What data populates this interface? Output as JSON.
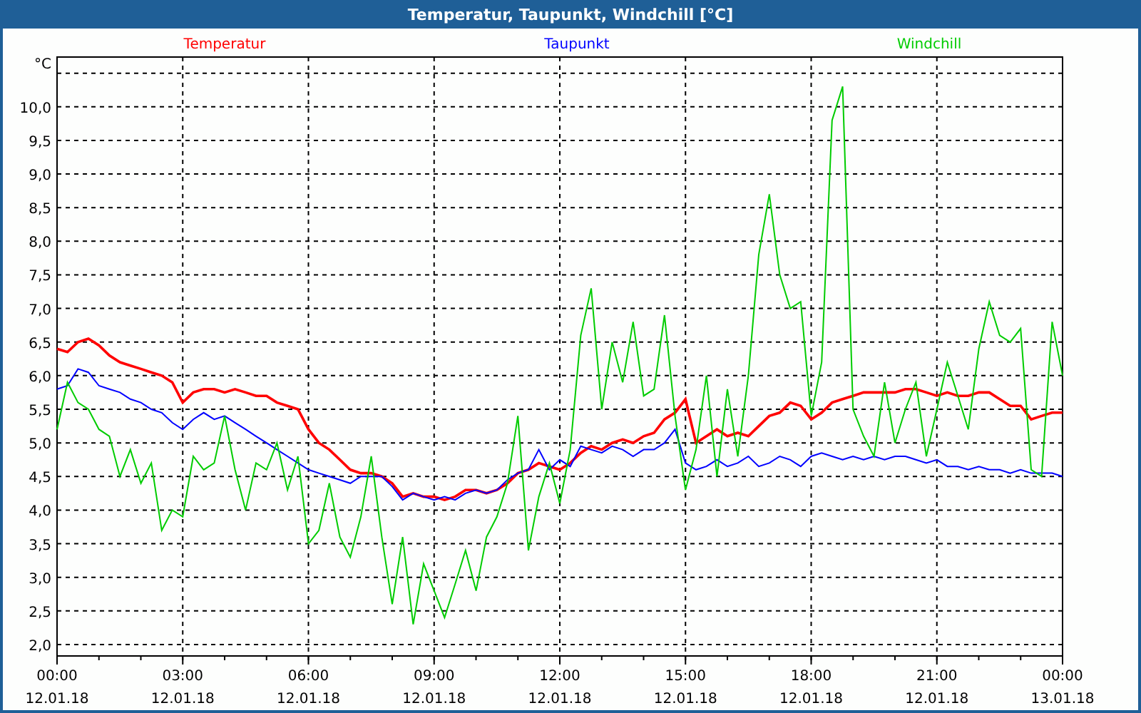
{
  "window": {
    "title": "Temperatur, Taupunkt, Windchill [°C]"
  },
  "chart": {
    "chart_data": {
      "type": "line",
      "ylabel": "°C",
      "categories": [
        "00:00\n12.01.18",
        null,
        null,
        null,
        null,
        null,
        null,
        null,
        null,
        null,
        null,
        null,
        "03:00\n12.01.18",
        null,
        null,
        null,
        null,
        null,
        null,
        null,
        null,
        null,
        null,
        null,
        "06:00\n12.01.18",
        null,
        null,
        null,
        null,
        null,
        null,
        null,
        null,
        null,
        null,
        null,
        "09:00\n12.01.18",
        null,
        null,
        null,
        null,
        null,
        null,
        null,
        null,
        null,
        null,
        null,
        "12:00\n12.01.18",
        null,
        null,
        null,
        null,
        null,
        null,
        null,
        null,
        null,
        null,
        null,
        "15:00\n12.01.18",
        null,
        null,
        null,
        null,
        null,
        null,
        null,
        null,
        null,
        null,
        null,
        "18:00\n12.01.18",
        null,
        null,
        null,
        null,
        null,
        null,
        null,
        null,
        null,
        null,
        null,
        "21:00\n12.01.18",
        null,
        null,
        null,
        null,
        null,
        null,
        null,
        null,
        null,
        null,
        null,
        "00:00\n13.01.18"
      ],
      "series": [
        {
          "name": "Temperatur",
          "color": "#ff0000",
          "values": [
            6.4,
            6.35,
            6.5,
            6.55,
            6.45,
            6.3,
            6.2,
            6.15,
            6.1,
            6.05,
            6.0,
            5.9,
            5.6,
            5.75,
            5.8,
            5.8,
            5.75,
            5.8,
            5.75,
            5.7,
            5.7,
            5.6,
            5.55,
            5.5,
            5.2,
            5.0,
            4.9,
            4.75,
            4.6,
            4.55,
            4.55,
            4.5,
            4.4,
            4.2,
            4.25,
            4.2,
            4.2,
            4.15,
            4.2,
            4.3,
            4.3,
            4.25,
            4.3,
            4.4,
            4.55,
            4.6,
            4.7,
            4.65,
            4.6,
            4.7,
            4.85,
            4.95,
            4.9,
            5.0,
            5.05,
            5.0,
            5.1,
            5.15,
            5.35,
            5.45,
            5.65,
            5.0,
            5.1,
            5.2,
            5.1,
            5.15,
            5.1,
            5.25,
            5.4,
            5.45,
            5.6,
            5.55,
            5.35,
            5.45,
            5.6,
            5.65,
            5.7,
            5.75,
            5.75,
            5.75,
            5.75,
            5.8,
            5.8,
            5.75,
            5.7,
            5.75,
            5.7,
            5.7,
            5.75,
            5.75,
            5.65,
            5.55,
            5.55,
            5.35,
            5.4,
            5.45,
            5.45
          ]
        },
        {
          "name": "Taupunkt",
          "color": "#0000ff",
          "values": [
            5.8,
            5.85,
            6.1,
            6.05,
            5.85,
            5.8,
            5.75,
            5.65,
            5.6,
            5.5,
            5.45,
            5.3,
            5.2,
            5.35,
            5.45,
            5.35,
            5.4,
            5.3,
            5.2,
            5.1,
            5.0,
            4.9,
            4.8,
            4.7,
            4.6,
            4.55,
            4.5,
            4.45,
            4.4,
            4.5,
            4.5,
            4.5,
            4.35,
            4.15,
            4.25,
            4.2,
            4.15,
            4.2,
            4.15,
            4.25,
            4.3,
            4.25,
            4.3,
            4.45,
            4.55,
            4.6,
            4.9,
            4.6,
            4.75,
            4.65,
            4.95,
            4.9,
            4.85,
            4.95,
            4.9,
            4.8,
            4.9,
            4.9,
            5.0,
            5.2,
            4.7,
            4.6,
            4.65,
            4.75,
            4.65,
            4.7,
            4.8,
            4.65,
            4.7,
            4.8,
            4.75,
            4.65,
            4.8,
            4.85,
            4.8,
            4.75,
            4.8,
            4.75,
            4.8,
            4.75,
            4.8,
            4.8,
            4.75,
            4.7,
            4.75,
            4.65,
            4.65,
            4.6,
            4.65,
            4.6,
            4.6,
            4.55,
            4.6,
            4.55,
            4.55,
            4.55,
            4.5
          ]
        },
        {
          "name": "Windchill",
          "color": "#00cc00",
          "values": [
            5.2,
            5.9,
            5.6,
            5.5,
            5.2,
            5.1,
            4.5,
            4.9,
            4.4,
            4.7,
            3.7,
            4.0,
            3.9,
            4.8,
            4.6,
            4.7,
            5.4,
            4.6,
            4.0,
            4.7,
            4.6,
            5.0,
            4.3,
            4.8,
            3.5,
            3.7,
            4.4,
            3.6,
            3.3,
            3.9,
            4.8,
            3.6,
            2.6,
            3.6,
            2.3,
            3.2,
            2.8,
            2.4,
            2.9,
            3.4,
            2.8,
            3.6,
            3.9,
            4.4,
            5.4,
            3.4,
            4.2,
            4.7,
            4.1,
            4.9,
            6.6,
            7.3,
            5.5,
            6.5,
            5.9,
            6.8,
            5.7,
            5.8,
            6.9,
            5.4,
            4.3,
            4.9,
            6.0,
            4.5,
            5.8,
            4.8,
            6.0,
            7.8,
            8.7,
            7.5,
            7.0,
            7.1,
            5.4,
            6.2,
            9.8,
            10.3,
            5.5,
            5.1,
            4.8,
            5.9,
            5.0,
            5.5,
            5.9,
            4.8,
            5.5,
            6.2,
            5.7,
            5.2,
            6.4,
            7.1,
            6.6,
            6.5,
            6.7,
            4.6,
            4.5,
            6.8,
            6.0
          ]
        }
      ],
      "ylim": [
        1.83,
        10.74
      ],
      "grid": true,
      "yticks": [
        {
          "value": 2,
          "label": "2,0"
        },
        {
          "value": 2.5,
          "label": "2,5"
        },
        {
          "value": 3,
          "label": "3,0"
        },
        {
          "value": 3.5,
          "label": "3,5"
        },
        {
          "value": 4,
          "label": "4,0"
        },
        {
          "value": 4.5,
          "label": "4,5"
        },
        {
          "value": 5,
          "label": "5,0"
        },
        {
          "value": 5.5,
          "label": "5,5"
        },
        {
          "value": 6,
          "label": "6,0"
        },
        {
          "value": 6.5,
          "label": "6,5"
        },
        {
          "value": 7,
          "label": "7,0"
        },
        {
          "value": 7.5,
          "label": "7,5"
        },
        {
          "value": 8,
          "label": "8,0"
        },
        {
          "value": 8.5,
          "label": "8,5"
        },
        {
          "value": 9,
          "label": "9,0"
        },
        {
          "value": 9.5,
          "label": "9,5"
        },
        {
          "value": 10,
          "label": "10,0"
        }
      ]
    }
  }
}
